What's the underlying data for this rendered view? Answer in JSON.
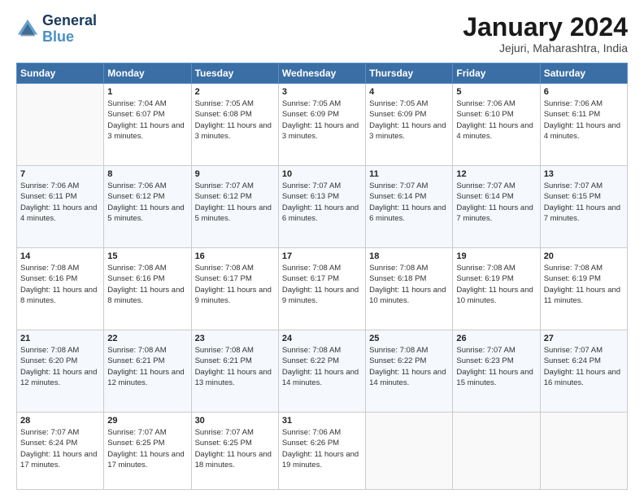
{
  "logo": {
    "line1": "General",
    "line2": "Blue"
  },
  "title": "January 2024",
  "subtitle": "Jejuri, Maharashtra, India",
  "weekdays": [
    "Sunday",
    "Monday",
    "Tuesday",
    "Wednesday",
    "Thursday",
    "Friday",
    "Saturday"
  ],
  "weeks": [
    [
      {
        "day": "",
        "sunrise": "",
        "sunset": "",
        "daylight": ""
      },
      {
        "day": "1",
        "sunrise": "Sunrise: 7:04 AM",
        "sunset": "Sunset: 6:07 PM",
        "daylight": "Daylight: 11 hours and 3 minutes."
      },
      {
        "day": "2",
        "sunrise": "Sunrise: 7:05 AM",
        "sunset": "Sunset: 6:08 PM",
        "daylight": "Daylight: 11 hours and 3 minutes."
      },
      {
        "day": "3",
        "sunrise": "Sunrise: 7:05 AM",
        "sunset": "Sunset: 6:09 PM",
        "daylight": "Daylight: 11 hours and 3 minutes."
      },
      {
        "day": "4",
        "sunrise": "Sunrise: 7:05 AM",
        "sunset": "Sunset: 6:09 PM",
        "daylight": "Daylight: 11 hours and 3 minutes."
      },
      {
        "day": "5",
        "sunrise": "Sunrise: 7:06 AM",
        "sunset": "Sunset: 6:10 PM",
        "daylight": "Daylight: 11 hours and 4 minutes."
      },
      {
        "day": "6",
        "sunrise": "Sunrise: 7:06 AM",
        "sunset": "Sunset: 6:11 PM",
        "daylight": "Daylight: 11 hours and 4 minutes."
      }
    ],
    [
      {
        "day": "7",
        "sunrise": "Sunrise: 7:06 AM",
        "sunset": "Sunset: 6:11 PM",
        "daylight": "Daylight: 11 hours and 4 minutes."
      },
      {
        "day": "8",
        "sunrise": "Sunrise: 7:06 AM",
        "sunset": "Sunset: 6:12 PM",
        "daylight": "Daylight: 11 hours and 5 minutes."
      },
      {
        "day": "9",
        "sunrise": "Sunrise: 7:07 AM",
        "sunset": "Sunset: 6:12 PM",
        "daylight": "Daylight: 11 hours and 5 minutes."
      },
      {
        "day": "10",
        "sunrise": "Sunrise: 7:07 AM",
        "sunset": "Sunset: 6:13 PM",
        "daylight": "Daylight: 11 hours and 6 minutes."
      },
      {
        "day": "11",
        "sunrise": "Sunrise: 7:07 AM",
        "sunset": "Sunset: 6:14 PM",
        "daylight": "Daylight: 11 hours and 6 minutes."
      },
      {
        "day": "12",
        "sunrise": "Sunrise: 7:07 AM",
        "sunset": "Sunset: 6:14 PM",
        "daylight": "Daylight: 11 hours and 7 minutes."
      },
      {
        "day": "13",
        "sunrise": "Sunrise: 7:07 AM",
        "sunset": "Sunset: 6:15 PM",
        "daylight": "Daylight: 11 hours and 7 minutes."
      }
    ],
    [
      {
        "day": "14",
        "sunrise": "Sunrise: 7:08 AM",
        "sunset": "Sunset: 6:16 PM",
        "daylight": "Daylight: 11 hours and 8 minutes."
      },
      {
        "day": "15",
        "sunrise": "Sunrise: 7:08 AM",
        "sunset": "Sunset: 6:16 PM",
        "daylight": "Daylight: 11 hours and 8 minutes."
      },
      {
        "day": "16",
        "sunrise": "Sunrise: 7:08 AM",
        "sunset": "Sunset: 6:17 PM",
        "daylight": "Daylight: 11 hours and 9 minutes."
      },
      {
        "day": "17",
        "sunrise": "Sunrise: 7:08 AM",
        "sunset": "Sunset: 6:17 PM",
        "daylight": "Daylight: 11 hours and 9 minutes."
      },
      {
        "day": "18",
        "sunrise": "Sunrise: 7:08 AM",
        "sunset": "Sunset: 6:18 PM",
        "daylight": "Daylight: 11 hours and 10 minutes."
      },
      {
        "day": "19",
        "sunrise": "Sunrise: 7:08 AM",
        "sunset": "Sunset: 6:19 PM",
        "daylight": "Daylight: 11 hours and 10 minutes."
      },
      {
        "day": "20",
        "sunrise": "Sunrise: 7:08 AM",
        "sunset": "Sunset: 6:19 PM",
        "daylight": "Daylight: 11 hours and 11 minutes."
      }
    ],
    [
      {
        "day": "21",
        "sunrise": "Sunrise: 7:08 AM",
        "sunset": "Sunset: 6:20 PM",
        "daylight": "Daylight: 11 hours and 12 minutes."
      },
      {
        "day": "22",
        "sunrise": "Sunrise: 7:08 AM",
        "sunset": "Sunset: 6:21 PM",
        "daylight": "Daylight: 11 hours and 12 minutes."
      },
      {
        "day": "23",
        "sunrise": "Sunrise: 7:08 AM",
        "sunset": "Sunset: 6:21 PM",
        "daylight": "Daylight: 11 hours and 13 minutes."
      },
      {
        "day": "24",
        "sunrise": "Sunrise: 7:08 AM",
        "sunset": "Sunset: 6:22 PM",
        "daylight": "Daylight: 11 hours and 14 minutes."
      },
      {
        "day": "25",
        "sunrise": "Sunrise: 7:08 AM",
        "sunset": "Sunset: 6:22 PM",
        "daylight": "Daylight: 11 hours and 14 minutes."
      },
      {
        "day": "26",
        "sunrise": "Sunrise: 7:07 AM",
        "sunset": "Sunset: 6:23 PM",
        "daylight": "Daylight: 11 hours and 15 minutes."
      },
      {
        "day": "27",
        "sunrise": "Sunrise: 7:07 AM",
        "sunset": "Sunset: 6:24 PM",
        "daylight": "Daylight: 11 hours and 16 minutes."
      }
    ],
    [
      {
        "day": "28",
        "sunrise": "Sunrise: 7:07 AM",
        "sunset": "Sunset: 6:24 PM",
        "daylight": "Daylight: 11 hours and 17 minutes."
      },
      {
        "day": "29",
        "sunrise": "Sunrise: 7:07 AM",
        "sunset": "Sunset: 6:25 PM",
        "daylight": "Daylight: 11 hours and 17 minutes."
      },
      {
        "day": "30",
        "sunrise": "Sunrise: 7:07 AM",
        "sunset": "Sunset: 6:25 PM",
        "daylight": "Daylight: 11 hours and 18 minutes."
      },
      {
        "day": "31",
        "sunrise": "Sunrise: 7:06 AM",
        "sunset": "Sunset: 6:26 PM",
        "daylight": "Daylight: 11 hours and 19 minutes."
      },
      {
        "day": "",
        "sunrise": "",
        "sunset": "",
        "daylight": ""
      },
      {
        "day": "",
        "sunrise": "",
        "sunset": "",
        "daylight": ""
      },
      {
        "day": "",
        "sunrise": "",
        "sunset": "",
        "daylight": ""
      }
    ]
  ]
}
